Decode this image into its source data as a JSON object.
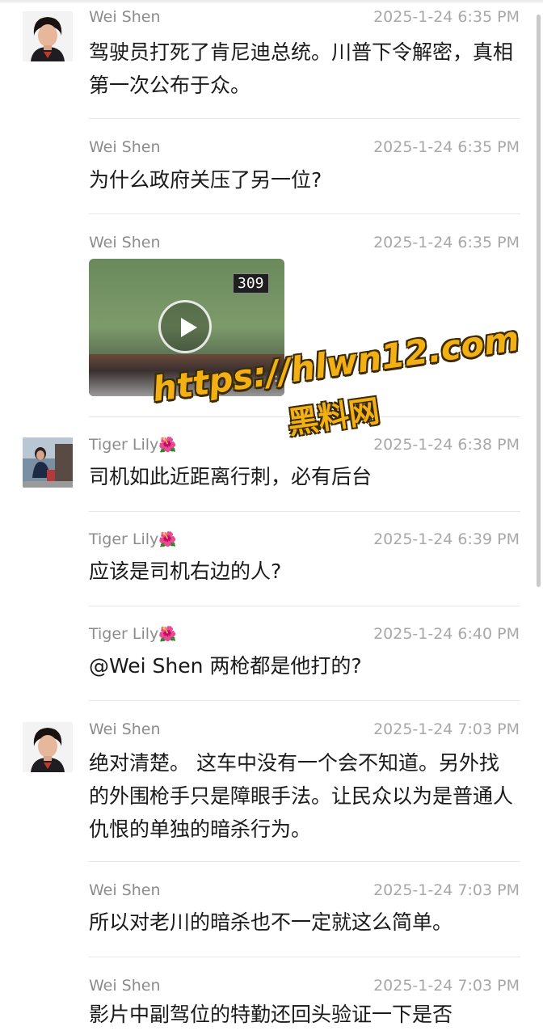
{
  "messages": [
    {
      "name": "Wei Shen",
      "time": "2025-1-24 6:35 PM",
      "text": "驾驶员打死了肯尼迪总统。川普下令解密，真相第一次公布于众。",
      "avatar": "wei-shen"
    },
    {
      "name": "Wei Shen",
      "time": "2025-1-24 6:35 PM",
      "text": "为什么政府关压了另一位?"
    },
    {
      "name": "Wei Shen",
      "time": "2025-1-24 6:35 PM",
      "video": {
        "counter": "309",
        "duration": "0:"
      }
    },
    {
      "name": "Tiger Lily",
      "flower": "🌺",
      "time": "2025-1-24 6:38 PM",
      "text": "司机如此近距离行刺，必有后台",
      "avatar": "tiger-lily"
    },
    {
      "name": "Tiger Lily",
      "flower": "🌺",
      "time": "2025-1-24 6:39 PM",
      "text": "应该是司机右边的人?"
    },
    {
      "name": "Tiger Lily",
      "flower": "🌺",
      "time": "2025-1-24 6:40 PM",
      "text": "@Wei Shen 两枪都是他打的?"
    },
    {
      "name": "Wei Shen",
      "time": "2025-1-24 7:03 PM",
      "text": "绝对清楚。 这车中没有一个会不知道。另外找的外围枪手只是障眼手法。让民众以为是普通人仇恨的单独的暗杀行为。",
      "avatar": "wei-shen"
    },
    {
      "name": "Wei Shen",
      "time": "2025-1-24 7:03 PM",
      "text": "所以对老川的暗杀也不一定就这么简单。"
    },
    {
      "name": "Wei Shen",
      "time": "2025-1-24 7:03 PM",
      "text": "影片中副驾位的特勤还回头验证一下是否"
    }
  ],
  "watermark": {
    "url": "https://hlwn12.com",
    "label": "黑料网"
  }
}
